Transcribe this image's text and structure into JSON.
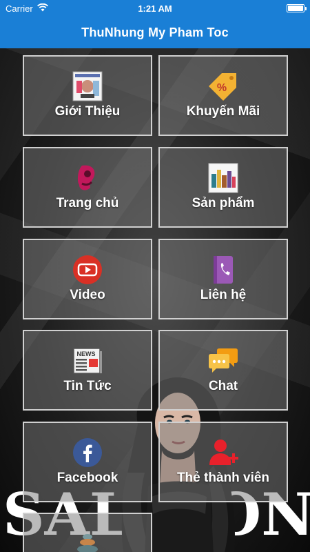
{
  "status_bar": {
    "carrier": "Carrier",
    "time": "1:21 AM",
    "battery_level": 1.0
  },
  "header": {
    "title": "ThuNhung My Pham Toc"
  },
  "background": {
    "banner_left": "SAL",
    "banner_right": "ON"
  },
  "menu": [
    {
      "label": "Giới Thiệu",
      "icon": "magazine-cover-icon"
    },
    {
      "label": "Khuyến Mãi",
      "icon": "percent-tag-icon"
    },
    {
      "label": "Trang chủ",
      "icon": "salon-logo-icon"
    },
    {
      "label": "Sản phẩm",
      "icon": "products-icon"
    },
    {
      "label": "Video",
      "icon": "youtube-play-icon"
    },
    {
      "label": "Liên hệ",
      "icon": "phone-book-icon"
    },
    {
      "label": "Tin Tức",
      "icon": "newspaper-icon",
      "icon_text": "NEWS"
    },
    {
      "label": "Chat",
      "icon": "chat-bubbles-icon"
    },
    {
      "label": "Facebook",
      "icon": "facebook-icon"
    },
    {
      "label": "Thẻ thành viên",
      "icon": "add-member-icon"
    },
    {
      "label": "",
      "icon": "stones-icon"
    }
  ],
  "colors": {
    "header_bg": "#1a7fd6",
    "tile_border": "#d0d0d0",
    "youtube_red": "#d93025",
    "facebook_blue": "#3b5998"
  }
}
